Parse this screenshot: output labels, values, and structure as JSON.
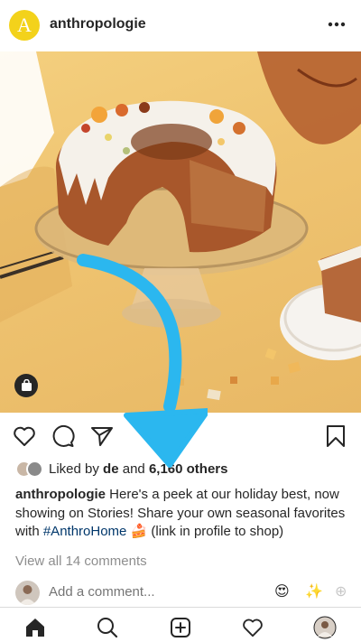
{
  "header": {
    "brand_initial": "A",
    "username": "anthropologie"
  },
  "icons": {
    "more": "more-horizontal-icon",
    "shop": "shopping-bag-icon",
    "like": "heart-icon",
    "comment": "comment-icon",
    "share": "paper-plane-icon",
    "save": "bookmark-icon",
    "home": "home-icon",
    "search": "search-icon",
    "new_post": "plus-square-icon",
    "activity": "heart-icon"
  },
  "likes": {
    "prefix": "Liked by ",
    "user": "de",
    "middle": " and ",
    "count": "6,160 others"
  },
  "caption": {
    "username": "anthropologie",
    "text_before": " Here's a peek at our holiday best, now showing on Stories! Share your own seasonal favorites with ",
    "hashtag": "#AnthroHome",
    "emoji": "🍰",
    "text_after": " (link in profile to shop)"
  },
  "comments": {
    "view_all": "View all 14 comments",
    "add_placeholder": "Add a comment...",
    "quick_emojis": [
      "😍",
      "✨",
      "⊕"
    ]
  },
  "colors": {
    "brand_yellow": "#f3d21b",
    "arrow_blue": "#2bb7ef",
    "hashtag_blue": "#00376b",
    "muted_text": "#8e8e8e"
  }
}
